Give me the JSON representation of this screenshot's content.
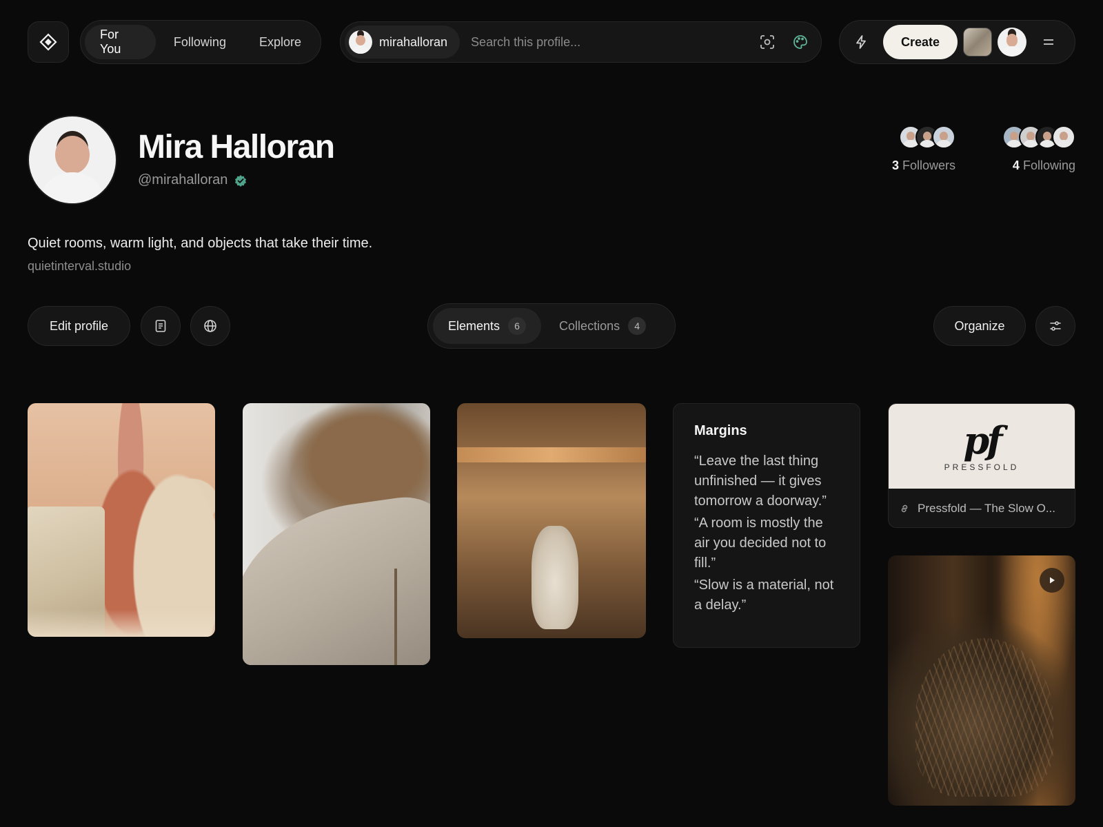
{
  "nav": {
    "tabs": [
      {
        "label": "For You",
        "active": true
      },
      {
        "label": "Following",
        "active": false
      },
      {
        "label": "Explore",
        "active": false
      }
    ]
  },
  "search": {
    "user_chip": "mirahalloran",
    "placeholder": "Search this profile..."
  },
  "top_actions": {
    "create_label": "Create"
  },
  "profile": {
    "name": "Mira Halloran",
    "handle": "@mirahalloran",
    "verified": true,
    "bio": "Quiet rooms, warm light, and objects that take their time.",
    "website": "quietinterval.studio"
  },
  "stats": {
    "followers_count": "3",
    "followers_label": "Followers",
    "following_count": "4",
    "following_label": "Following"
  },
  "actions": {
    "edit_profile": "Edit profile",
    "organize": "Organize"
  },
  "segments": [
    {
      "label": "Elements",
      "count": "6",
      "active": true
    },
    {
      "label": "Collections",
      "count": "4",
      "active": false
    }
  ],
  "text_card": {
    "title": "Margins",
    "quotes": [
      "“Leave the last thing unfinished — it gives tomorrow a doorway.”",
      "“A room is mostly the air you decided not to fill.”",
      "“Slow is a material, not a delay.”"
    ]
  },
  "link_card": {
    "logo_mark": "pf",
    "logo_word": "PRESSFOLD",
    "title": "Pressfold — The Slow O..."
  },
  "colors": {
    "background": "#0a0a0a",
    "surface": "#161616",
    "verified": "#4fa38a",
    "create_button": "#f3f0ea"
  },
  "icons": [
    "diamond-logo-icon",
    "scan-icon",
    "palette-icon",
    "bolt-icon",
    "menu-icon",
    "verified-badge-icon",
    "document-icon",
    "globe-icon",
    "sliders-icon",
    "link-icon",
    "play-icon"
  ]
}
